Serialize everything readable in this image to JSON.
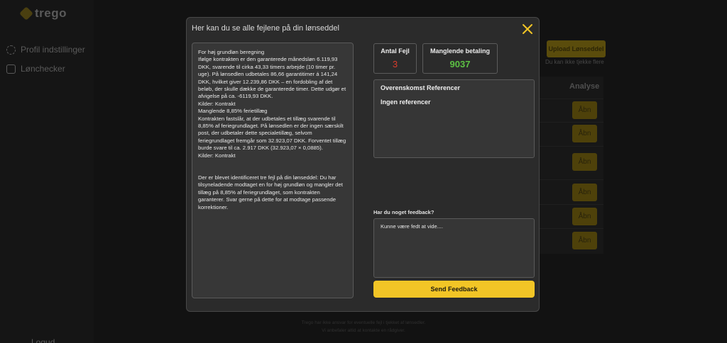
{
  "app": {
    "logo_text": "trego",
    "nav": [
      {
        "label": "Profil indstillinger",
        "icon": "gear-icon"
      },
      {
        "label": "Lønchecker",
        "icon": "list-icon"
      }
    ],
    "logout_label": "Logud",
    "upload_label": "Upload Lønseddel",
    "upload_note": "Du kan ikke tjekke flere",
    "table_header_analyse": "Analyse",
    "open_label": "Åbn",
    "footer_line1": "Trego har ikke ansvar for eventuelle fejl i tjekket af lønsedler.",
    "footer_line2": "Vi anbefaler altid at kontakte en rådgiver."
  },
  "modal": {
    "title": "Her kan du se alle fejlene på din lønseddel",
    "close_icon": "close-icon",
    "close_color": "#f2c526",
    "report_paragraphs": [
      "For høj grundløn beregning",
      "Ifølge kontrakten er den garanterede månedsløn 6.119,93 DKK, svarende til cirka 43,33 timers arbejde (10 timer pr. uge). På lønsedlen udbetales 86,66 garantitimer á 141,24 DKK, hvilket giver 12.239,86 DKK – en fordobling af det beløb, der skulle dække de garanterede timer. Dette udgør et afvigelse på ca. -6119,93 DKK.",
      "Kilder: Kontrakt",
      "Manglende 8,85% ferietillæg",
      "Kontrakten fastslår, at der udbetales et tillæg svarende til 8,85% af feriegrundlaget. På lønsedlen er der ingen særskilt post, der udbetaler dette specialetillæg, selvom feriegrundlaget fremgår som 32.923,07 DKK. Forventet tillæg burde svare til ca. 2.917 DKK (32.923,07 × 0,0885).",
      "Kilder: Kontrakt"
    ],
    "summary": "Der er blevet identificeret tre fejl på din lønseddel: Du har tilsyneladende modtaget en for høj grundløn og mangler det tillæg på 8,85% af feriegrundlaget, som kontrakten garanterer. Svar gerne på dette for at modtage passende korrektioner.",
    "stats": {
      "errors_label": "Antal Fejl",
      "errors_value": "3",
      "errors_color": "#d93c2c",
      "missing_label": "Manglende betaling",
      "missing_value": "9037",
      "missing_color": "#5cc043"
    },
    "references": {
      "title": "Overenskomst Referencer",
      "empty_text": "Ingen referencer"
    },
    "feedback": {
      "label": "Har du noget feedback?",
      "value": "Kunne være fedt at vide....",
      "placeholder": ""
    },
    "send_label": "Send Feedback",
    "accent_color": "#f2c526"
  }
}
